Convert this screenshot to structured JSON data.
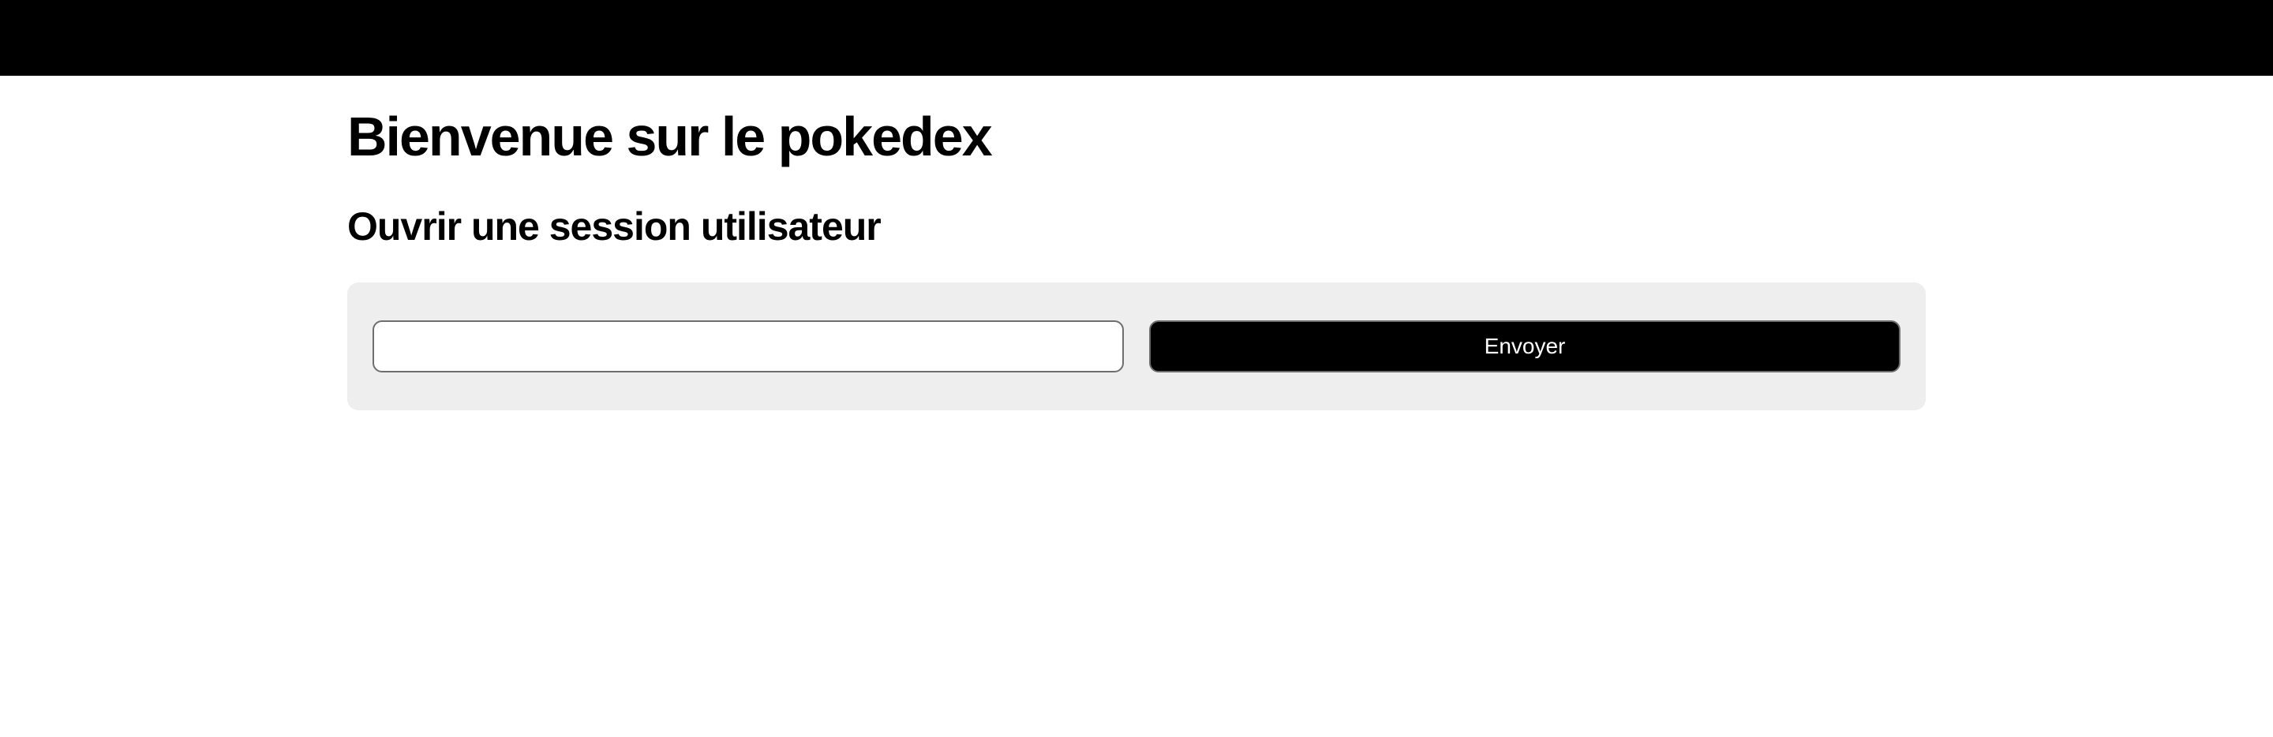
{
  "header": {
    "background": "#000000"
  },
  "main": {
    "title": "Bienvenue sur le pokedex",
    "subtitle": "Ouvrir une session utilisateur"
  },
  "login_form": {
    "username_value": "",
    "username_placeholder": "",
    "submit_label": "Envoyer",
    "panel_color": "#eeeeee",
    "button_color": "#000000"
  }
}
